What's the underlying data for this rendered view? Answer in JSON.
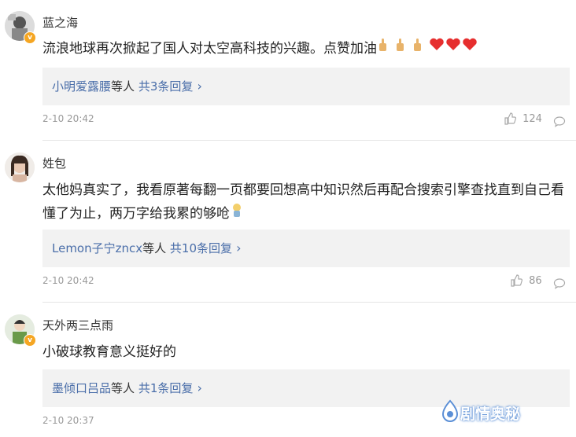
{
  "comments": [
    {
      "username": "蓝之海",
      "text": "流浪地球再次掀起了国人对太空高科技的兴趣。点赞加油",
      "reply_users": "小明爱露腰",
      "reply_suffix": "等人",
      "reply_count": "共3条回复",
      "time": "2-10 20:42",
      "likes": "124",
      "verified": true
    },
    {
      "username": "姓包",
      "text": "太他妈真实了，我看原著每翻一页都要回想高中知识然后再配合搜索引擎查找直到自己看懂了为止，两万字给我累的够呛",
      "reply_users": "Lemon子宁zncx",
      "reply_suffix": "等人",
      "reply_count": "共10条回复",
      "time": "2-10 20:42",
      "likes": "86",
      "verified": false
    },
    {
      "username": "天外两三点雨",
      "text": "小破球教育意义挺好的",
      "reply_users": "墨倾口吕品",
      "reply_suffix": "等人",
      "reply_count": "共1条回复",
      "time": "2-10 20:37",
      "likes": "",
      "verified": true
    }
  ],
  "watermark": "剧情奥秘",
  "icons": {
    "like": "thumbs-up-icon",
    "comment": "comment-bubble-icon",
    "chevron": "chevron-right-icon",
    "verified": "verified-badge-icon"
  },
  "colors": {
    "link": "#4a6ea9",
    "reply_bg": "#f2f2f2",
    "meta": "#999999",
    "badge": "#f5a623"
  }
}
